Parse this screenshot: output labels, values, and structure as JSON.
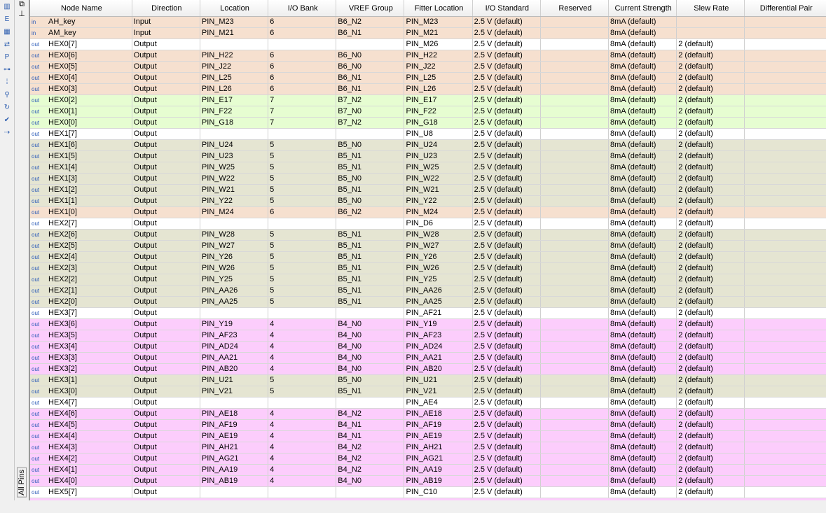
{
  "sidebar": {
    "tab_label": "All Pins"
  },
  "columns": [
    "Node Name",
    "Direction",
    "Location",
    "I/O Bank",
    "VREF Group",
    "Fitter Location",
    "I/O Standard",
    "Reserved",
    "Current Strength",
    "Slew Rate",
    "Differential Pair"
  ],
  "rows": [
    [
      "AH_key",
      "Input",
      "PIN_M23",
      "6",
      "B6_N2",
      "PIN_M23",
      "2.5 V (default)",
      "",
      "8mA (default)",
      "",
      ""
    ],
    [
      "AM_key",
      "Input",
      "PIN_M21",
      "6",
      "B6_N1",
      "PIN_M21",
      "2.5 V (default)",
      "",
      "8mA (default)",
      "",
      ""
    ],
    [
      "HEX0[7]",
      "Output",
      "",
      "",
      "",
      "PIN_M26",
      "2.5 V (default)",
      "",
      "8mA (default)",
      "2 (default)",
      ""
    ],
    [
      "HEX0[6]",
      "Output",
      "PIN_H22",
      "6",
      "B6_N0",
      "PIN_H22",
      "2.5 V (default)",
      "",
      "8mA (default)",
      "2 (default)",
      ""
    ],
    [
      "HEX0[5]",
      "Output",
      "PIN_J22",
      "6",
      "B6_N0",
      "PIN_J22",
      "2.5 V (default)",
      "",
      "8mA (default)",
      "2 (default)",
      ""
    ],
    [
      "HEX0[4]",
      "Output",
      "PIN_L25",
      "6",
      "B6_N1",
      "PIN_L25",
      "2.5 V (default)",
      "",
      "8mA (default)",
      "2 (default)",
      ""
    ],
    [
      "HEX0[3]",
      "Output",
      "PIN_L26",
      "6",
      "B6_N1",
      "PIN_L26",
      "2.5 V (default)",
      "",
      "8mA (default)",
      "2 (default)",
      ""
    ],
    [
      "HEX0[2]",
      "Output",
      "PIN_E17",
      "7",
      "B7_N2",
      "PIN_E17",
      "2.5 V (default)",
      "",
      "8mA (default)",
      "2 (default)",
      ""
    ],
    [
      "HEX0[1]",
      "Output",
      "PIN_F22",
      "7",
      "B7_N0",
      "PIN_F22",
      "2.5 V (default)",
      "",
      "8mA (default)",
      "2 (default)",
      ""
    ],
    [
      "HEX0[0]",
      "Output",
      "PIN_G18",
      "7",
      "B7_N2",
      "PIN_G18",
      "2.5 V (default)",
      "",
      "8mA (default)",
      "2 (default)",
      ""
    ],
    [
      "HEX1[7]",
      "Output",
      "",
      "",
      "",
      "PIN_U8",
      "2.5 V (default)",
      "",
      "8mA (default)",
      "2 (default)",
      ""
    ],
    [
      "HEX1[6]",
      "Output",
      "PIN_U24",
      "5",
      "B5_N0",
      "PIN_U24",
      "2.5 V (default)",
      "",
      "8mA (default)",
      "2 (default)",
      ""
    ],
    [
      "HEX1[5]",
      "Output",
      "PIN_U23",
      "5",
      "B5_N1",
      "PIN_U23",
      "2.5 V (default)",
      "",
      "8mA (default)",
      "2 (default)",
      ""
    ],
    [
      "HEX1[4]",
      "Output",
      "PIN_W25",
      "5",
      "B5_N1",
      "PIN_W25",
      "2.5 V (default)",
      "",
      "8mA (default)",
      "2 (default)",
      ""
    ],
    [
      "HEX1[3]",
      "Output",
      "PIN_W22",
      "5",
      "B5_N0",
      "PIN_W22",
      "2.5 V (default)",
      "",
      "8mA (default)",
      "2 (default)",
      ""
    ],
    [
      "HEX1[2]",
      "Output",
      "PIN_W21",
      "5",
      "B5_N1",
      "PIN_W21",
      "2.5 V (default)",
      "",
      "8mA (default)",
      "2 (default)",
      ""
    ],
    [
      "HEX1[1]",
      "Output",
      "PIN_Y22",
      "5",
      "B5_N0",
      "PIN_Y22",
      "2.5 V (default)",
      "",
      "8mA (default)",
      "2 (default)",
      ""
    ],
    [
      "HEX1[0]",
      "Output",
      "PIN_M24",
      "6",
      "B6_N2",
      "PIN_M24",
      "2.5 V (default)",
      "",
      "8mA (default)",
      "2 (default)",
      ""
    ],
    [
      "HEX2[7]",
      "Output",
      "",
      "",
      "",
      "PIN_D6",
      "2.5 V (default)",
      "",
      "8mA (default)",
      "2 (default)",
      ""
    ],
    [
      "HEX2[6]",
      "Output",
      "PIN_W28",
      "5",
      "B5_N1",
      "PIN_W28",
      "2.5 V (default)",
      "",
      "8mA (default)",
      "2 (default)",
      ""
    ],
    [
      "HEX2[5]",
      "Output",
      "PIN_W27",
      "5",
      "B5_N1",
      "PIN_W27",
      "2.5 V (default)",
      "",
      "8mA (default)",
      "2 (default)",
      ""
    ],
    [
      "HEX2[4]",
      "Output",
      "PIN_Y26",
      "5",
      "B5_N1",
      "PIN_Y26",
      "2.5 V (default)",
      "",
      "8mA (default)",
      "2 (default)",
      ""
    ],
    [
      "HEX2[3]",
      "Output",
      "PIN_W26",
      "5",
      "B5_N1",
      "PIN_W26",
      "2.5 V (default)",
      "",
      "8mA (default)",
      "2 (default)",
      ""
    ],
    [
      "HEX2[2]",
      "Output",
      "PIN_Y25",
      "5",
      "B5_N1",
      "PIN_Y25",
      "2.5 V (default)",
      "",
      "8mA (default)",
      "2 (default)",
      ""
    ],
    [
      "HEX2[1]",
      "Output",
      "PIN_AA26",
      "5",
      "B5_N1",
      "PIN_AA26",
      "2.5 V (default)",
      "",
      "8mA (default)",
      "2 (default)",
      ""
    ],
    [
      "HEX2[0]",
      "Output",
      "PIN_AA25",
      "5",
      "B5_N1",
      "PIN_AA25",
      "2.5 V (default)",
      "",
      "8mA (default)",
      "2 (default)",
      ""
    ],
    [
      "HEX3[7]",
      "Output",
      "",
      "",
      "",
      "PIN_AF21",
      "2.5 V (default)",
      "",
      "8mA (default)",
      "2 (default)",
      ""
    ],
    [
      "HEX3[6]",
      "Output",
      "PIN_Y19",
      "4",
      "B4_N0",
      "PIN_Y19",
      "2.5 V (default)",
      "",
      "8mA (default)",
      "2 (default)",
      ""
    ],
    [
      "HEX3[5]",
      "Output",
      "PIN_AF23",
      "4",
      "B4_N0",
      "PIN_AF23",
      "2.5 V (default)",
      "",
      "8mA (default)",
      "2 (default)",
      ""
    ],
    [
      "HEX3[4]",
      "Output",
      "PIN_AD24",
      "4",
      "B4_N0",
      "PIN_AD24",
      "2.5 V (default)",
      "",
      "8mA (default)",
      "2 (default)",
      ""
    ],
    [
      "HEX3[3]",
      "Output",
      "PIN_AA21",
      "4",
      "B4_N0",
      "PIN_AA21",
      "2.5 V (default)",
      "",
      "8mA (default)",
      "2 (default)",
      ""
    ],
    [
      "HEX3[2]",
      "Output",
      "PIN_AB20",
      "4",
      "B4_N0",
      "PIN_AB20",
      "2.5 V (default)",
      "",
      "8mA (default)",
      "2 (default)",
      ""
    ],
    [
      "HEX3[1]",
      "Output",
      "PIN_U21",
      "5",
      "B5_N0",
      "PIN_U21",
      "2.5 V (default)",
      "",
      "8mA (default)",
      "2 (default)",
      ""
    ],
    [
      "HEX3[0]",
      "Output",
      "PIN_V21",
      "5",
      "B5_N1",
      "PIN_V21",
      "2.5 V (default)",
      "",
      "8mA (default)",
      "2 (default)",
      ""
    ],
    [
      "HEX4[7]",
      "Output",
      "",
      "",
      "",
      "PIN_AE4",
      "2.5 V (default)",
      "",
      "8mA (default)",
      "2 (default)",
      ""
    ],
    [
      "HEX4[6]",
      "Output",
      "PIN_AE18",
      "4",
      "B4_N2",
      "PIN_AE18",
      "2.5 V (default)",
      "",
      "8mA (default)",
      "2 (default)",
      ""
    ],
    [
      "HEX4[5]",
      "Output",
      "PIN_AF19",
      "4",
      "B4_N1",
      "PIN_AF19",
      "2.5 V (default)",
      "",
      "8mA (default)",
      "2 (default)",
      ""
    ],
    [
      "HEX4[4]",
      "Output",
      "PIN_AE19",
      "4",
      "B4_N1",
      "PIN_AE19",
      "2.5 V (default)",
      "",
      "8mA (default)",
      "2 (default)",
      ""
    ],
    [
      "HEX4[3]",
      "Output",
      "PIN_AH21",
      "4",
      "B4_N2",
      "PIN_AH21",
      "2.5 V (default)",
      "",
      "8mA (default)",
      "2 (default)",
      ""
    ],
    [
      "HEX4[2]",
      "Output",
      "PIN_AG21",
      "4",
      "B4_N2",
      "PIN_AG21",
      "2.5 V (default)",
      "",
      "8mA (default)",
      "2 (default)",
      ""
    ],
    [
      "HEX4[1]",
      "Output",
      "PIN_AA19",
      "4",
      "B4_N2",
      "PIN_AA19",
      "2.5 V (default)",
      "",
      "8mA (default)",
      "2 (default)",
      ""
    ],
    [
      "HEX4[0]",
      "Output",
      "PIN_AB19",
      "4",
      "B4_N0",
      "PIN_AB19",
      "2.5 V (default)",
      "",
      "8mA (default)",
      "2 (default)",
      ""
    ],
    [
      "HEX5[7]",
      "Output",
      "",
      "",
      "",
      "PIN_C10",
      "2.5 V (default)",
      "",
      "8mA (default)",
      "2 (default)",
      ""
    ]
  ],
  "bank_colors": {
    "4": "#fccdfc",
    "5": "#e5e5d2",
    "6": "#f6e0cf",
    "7": "#e6fdd1",
    "": "#ffffff"
  },
  "pin_icons": {
    "Input": "in",
    "Output": "out"
  }
}
